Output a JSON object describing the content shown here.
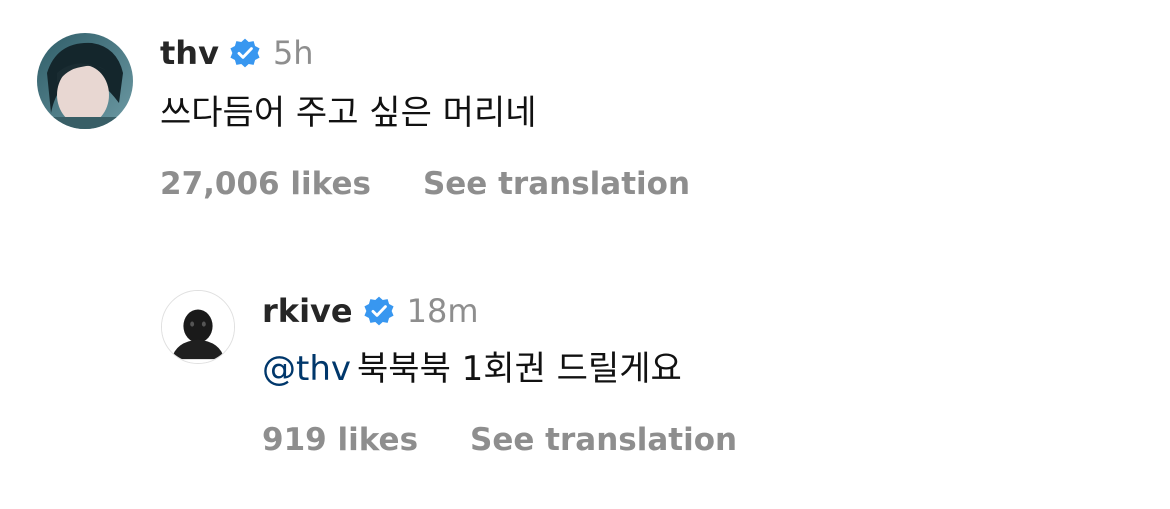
{
  "comments": [
    {
      "username": "thv",
      "time": "5h",
      "text": "쓰다듬어 주고 싶은 머리네",
      "likes": "27,006 likes",
      "translate": "See translation",
      "avatar_icon": "profile-photo-icon"
    },
    {
      "username": "rkive",
      "time": "18m",
      "mention": "@thv",
      "text": "북북북 1회권 드릴게요",
      "likes": "919 likes",
      "translate": "See translation",
      "avatar_icon": "profile-photo-icon"
    }
  ],
  "colors": {
    "verified": "#3897f0",
    "mention": "#00376b",
    "secondary_text": "#8e8e8e"
  }
}
